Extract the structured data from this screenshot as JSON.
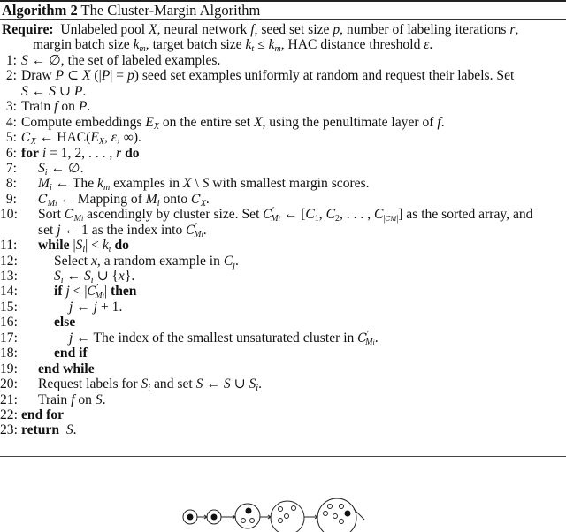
{
  "algorithm": {
    "label": "Algorithm 2",
    "title": "The Cluster-Margin Algorithm",
    "require_keyword": "Require:",
    "require_line1": "Unlabeled pool X, neural network f, seed set size p, number of labeling iterations r,",
    "require_line2": "margin batch size k_m, target batch size k_t ≤ k_m, HAC distance threshold ε.",
    "steps": [
      {
        "n": "1:",
        "text": "S ← ∅, the set of labeled examples."
      },
      {
        "n": "2:",
        "text": "Draw P ⊂ X (|P| = p) seed set examples uniformly at random and request their labels. Set",
        "cont": "S ← S ∪ P."
      },
      {
        "n": "3:",
        "text": "Train f on P."
      },
      {
        "n": "4:",
        "text": "Compute embeddings E_X on the entire set X, using the penultimate layer of f."
      },
      {
        "n": "5:",
        "text": "C_X ← HAC(E_X, ε, ∞)."
      },
      {
        "n": "6:",
        "keyword": "for",
        "text": "i = 1, 2, . . . , r",
        "keyword_end": "do"
      },
      {
        "n": "7:",
        "text": "S_i ← ∅."
      },
      {
        "n": "8:",
        "text": "M_i ← The k_m examples in X \\ S with smallest margin scores."
      },
      {
        "n": "9:",
        "text": "C_{M_i} ← Mapping of M_i onto C_X."
      },
      {
        "n": "10:",
        "text": "Sort C_{M_i} ascendingly by cluster size. Set C'_{M_i} ← [C_1, C_2, . . . , C_{|C_{M_i}|}] as the sorted array, and",
        "cont": "set j ← 1 as the index into C'_{M_i}."
      },
      {
        "n": "11:",
        "keyword": "while",
        "text": "|S_i| < k_t",
        "keyword_end": "do"
      },
      {
        "n": "12:",
        "text": "Select x, a random example in C_j."
      },
      {
        "n": "13:",
        "text": "S_i ← S_i ∪ {x}."
      },
      {
        "n": "14:",
        "keyword": "if",
        "text": "j < |C'_{M_i}|",
        "keyword_end": "then"
      },
      {
        "n": "15:",
        "text": "j ← j + 1."
      },
      {
        "n": "16:",
        "keyword": "else"
      },
      {
        "n": "17:",
        "text": "j ← The index of the smallest unsaturated cluster in C'_{M_i}."
      },
      {
        "n": "18:",
        "keyword": "end if"
      },
      {
        "n": "19:",
        "keyword": "end while"
      },
      {
        "n": "20:",
        "text": "Request labels for S_i and set S ← S ∪ S_i."
      },
      {
        "n": "21:",
        "text": "Train f on S."
      },
      {
        "n": "22:",
        "keyword": "end for"
      },
      {
        "n": "23:",
        "keyword": "return",
        "text": "S."
      }
    ]
  },
  "txt": {
    "r1a": "Unlabeled pool ",
    "X": "X",
    "r1b": ", neural network ",
    "f": "f",
    "r1c": ", seed set size ",
    "p": "p",
    "r1d": ", number of labeling iterations ",
    "r": "r",
    "comma": ",",
    "period": ".",
    "r2a": "margin batch size ",
    "k": "k",
    "m": "m",
    "t": "t",
    "r2b": ", target batch size ",
    "le": " ≤ ",
    "r2c": ", HAC distance threshold ",
    "eps": "ε",
    "S": "S",
    "larr": " ← ",
    "empty": "∅",
    "s1b": ", the set of labeled examples.",
    "s2a": "Draw ",
    "P": "P",
    "subset": " ⊂ ",
    "s2b": " (|",
    "s2c": "| = ",
    "s2d": ") seed set examples uniformly at random and request their labels. Set",
    "cup": " ∪ ",
    "s3a": "Train ",
    "s3b": " on ",
    "s4a": "Compute embeddings ",
    "E": "E",
    "s4b": " on the entire set ",
    "s4c": ", using the penultimate layer of ",
    "C": "C",
    "hac": "HAC(",
    "inf": ", ∞).",
    "comma_sp": ", ",
    "kw_for": "for",
    "i": "i",
    "s6": " = 1, 2, . . . , ",
    "kw_do": "do",
    "M": "M",
    "s8a": "The ",
    "s8b": " examples in ",
    "setminus": " \\ ",
    "s8c": " with smallest margin scores.",
    "s9a": "Mapping of ",
    "s9b": " onto ",
    "s10a": "Sort ",
    "s10b": " ascendingly by cluster size. Set ",
    "prime": "′",
    "s10c": "[",
    "s10d": ", ",
    "s10e": ", . . . , ",
    "s10f": "] as the sorted array, and",
    "s10g": "set ",
    "j": "j",
    "s10h": "1 as the index into ",
    "kw_while": "while",
    "bar": "|",
    "lt": " < ",
    "s12a": "Select ",
    "x": "x",
    "s12b": ", a random example in ",
    "s13": "{",
    "s13b": "}.",
    "kw_if": "if",
    "kw_then": "then",
    "s15": " + 1.",
    "kw_else": "else",
    "s17": "The index of the smallest unsaturated cluster in ",
    "kw_endif": "end if",
    "kw_endwhile": "end while",
    "s20a": "Request labels for ",
    "s20b": " and set ",
    "kw_endfor": "end for",
    "kw_return": "return"
  },
  "figure": {
    "description": "Sequence of clusters of increasing size connected by arrows; filled dots mark selected examples",
    "clusters": [
      {
        "size": "small",
        "hollow_points": 0,
        "filled_points": 1
      },
      {
        "size": "small",
        "hollow_points": 0,
        "filled_points": 1
      },
      {
        "size": "medium",
        "hollow_points": 2,
        "filled_points": 1
      },
      {
        "size": "large",
        "hollow_points": 4,
        "filled_points": 0
      },
      {
        "size": "larger",
        "hollow_points": 5,
        "filled_points": 1
      }
    ]
  }
}
